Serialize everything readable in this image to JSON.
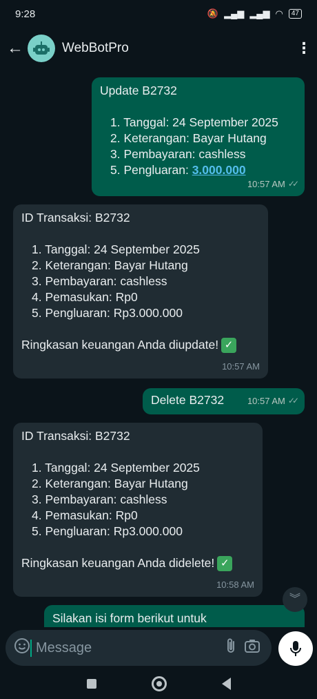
{
  "status_bar": {
    "time": "9:28",
    "battery": "47"
  },
  "app_bar": {
    "title": "WebBotPro"
  },
  "messages": [
    {
      "direction": "out",
      "header": "Update B2732",
      "items": [
        "1. Tanggal: 24 September 2025",
        "2. Keterangan: Bayar Hutang",
        "3. Pembayaran: cashless",
        "5. Pengluaran: "
      ],
      "link": "3.000.000",
      "time": "10:57 AM"
    },
    {
      "direction": "in",
      "header": "ID Transaksi: B2732",
      "items": [
        "1. Tanggal: 24 September 2025",
        "2. Keterangan: Bayar Hutang",
        "3. Pembayaran: cashless",
        "4. Pemasukan: Rp0",
        "5. Pengluaran: Rp3.000.000"
      ],
      "footer": "Ringkasan keuangan Anda diupdate!",
      "time": "10:57 AM"
    },
    {
      "direction": "out",
      "header": "Delete B2732",
      "time": "10:57 AM"
    },
    {
      "direction": "in",
      "header": "ID Transaksi: B2732",
      "items": [
        "1. Tanggal: 24 September 2025",
        "2. Keterangan: Bayar Hutang",
        "3. Pembayaran: cashless",
        "4. Pemasukan: Rp0",
        "5. Pengluaran: Rp3.000.000"
      ],
      "footer": "Ringkasan keuangan Anda didelete!",
      "time": "10:58 AM"
    },
    {
      "direction": "out",
      "header": "Silakan isi form berikut untuk"
    }
  ],
  "composer": {
    "placeholder": "Message"
  },
  "icons": {
    "back": "arrow-left-icon",
    "menu": "more-vertical-icon",
    "emoji": "sticker-icon",
    "attach": "paperclip-icon",
    "camera": "camera-icon",
    "mic": "microphone-icon",
    "scroll": "double-chevron-down-icon"
  },
  "colors": {
    "outgoing": "#005c4b",
    "incoming": "#202c33",
    "accent": "#00a884",
    "link": "#53bdeb"
  }
}
